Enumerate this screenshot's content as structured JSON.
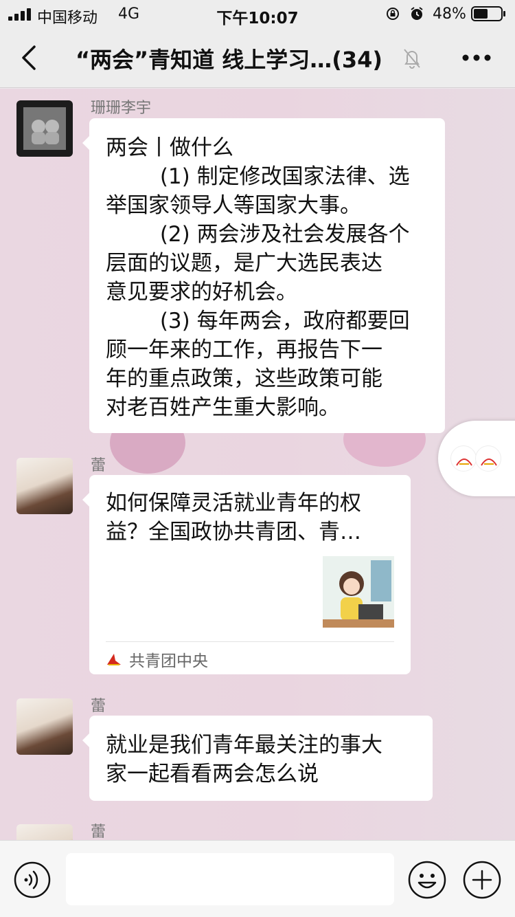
{
  "status_bar": {
    "carrier": "中国移动",
    "network": "4G",
    "time": "下午10:07",
    "battery": "48%"
  },
  "nav": {
    "title": "“两会”青知道 线上学习…(34)"
  },
  "messages": [
    {
      "sender": "珊珊李宇",
      "type": "text",
      "lines": [
        "两会丨做什么",
        "        (1) 制定修改国家法律、选",
        "举国家领导人等国家大事。",
        "        (2) 两会涉及社会发展各个",
        "层面的议题，是广大选民表达",
        "意见要求的好机会。",
        "        (3) 每年两会，政府都要回",
        "顾一年来的工作，再报告下一",
        "年的重点政策，这些政策可能",
        "对老百姓产生重大影响。"
      ]
    },
    {
      "sender": "蕾",
      "type": "link_card",
      "title_lines": [
        "如何保障灵活就业青年的权",
        "益？全国政协共青团、青…"
      ],
      "source": "共青团中央"
    },
    {
      "sender": "蕾",
      "type": "text",
      "lines": [
        "就业是我们青年最关注的事大",
        "家一起看看两会怎么说"
      ]
    },
    {
      "sender": "蕾",
      "type": "partial"
    }
  ],
  "icons": {
    "back": "chevron-left",
    "mute": "bell-slash",
    "more": "ellipsis",
    "voice": "voice-wave",
    "emoji": "smiley",
    "plus": "plus-circle"
  },
  "colors": {
    "nav_bg": "#ededed",
    "chat_bg": "#ead7e1",
    "bubble": "#ffffff"
  }
}
